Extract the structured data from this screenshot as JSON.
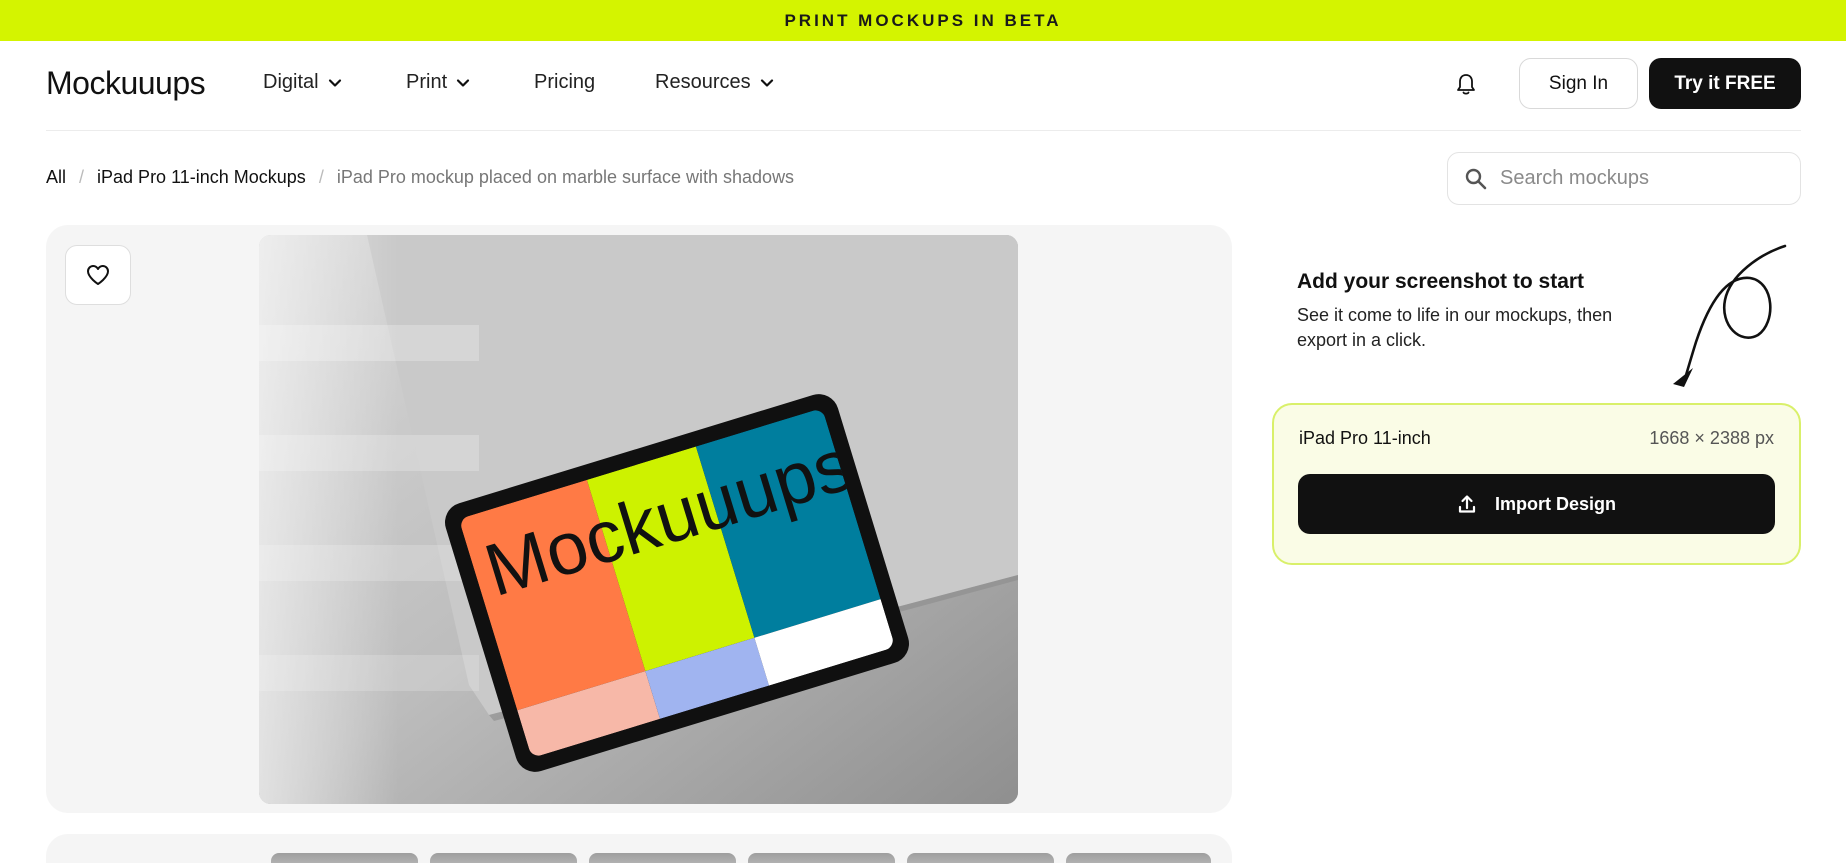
{
  "banner": {
    "text": "PRINT MOCKUPS IN BETA"
  },
  "header": {
    "logo": "Mockuuups",
    "nav": [
      {
        "label": "Digital",
        "has_dropdown": true
      },
      {
        "label": "Print",
        "has_dropdown": true
      },
      {
        "label": "Pricing",
        "has_dropdown": false
      },
      {
        "label": "Resources",
        "has_dropdown": true
      }
    ],
    "sign_in_label": "Sign In",
    "try_label": "Try it FREE"
  },
  "breadcrumb": {
    "items": [
      "All",
      "iPad Pro 11-inch Mockups"
    ],
    "current": "iPad Pro mockup placed on marble surface with shadows"
  },
  "search": {
    "placeholder": "Search mockups",
    "value": ""
  },
  "preview": {
    "screen_text": "Mockuuups",
    "screen_colors": [
      "#ff7a45",
      "#cdf200",
      "#007e9e",
      "#f7b8a8",
      "#a0b4f0",
      "#ffffff"
    ]
  },
  "sidebar": {
    "title": "Add your screenshot to start",
    "description": "See it come to life in our mockups, then export in a click.",
    "device_name": "iPad Pro 11-inch",
    "device_size": "1668 × 2388 px",
    "import_label": "Import Design"
  },
  "colors": {
    "accent": "#d4f400",
    "primary_button": "#111111",
    "card_bg": "#fafce6"
  }
}
